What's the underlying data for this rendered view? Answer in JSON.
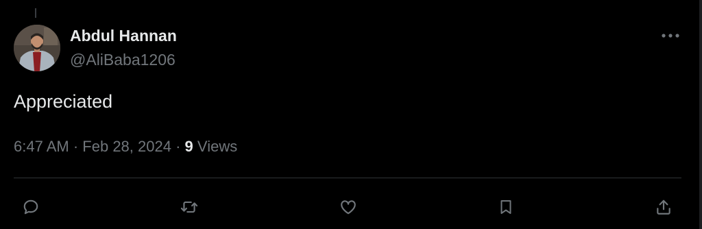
{
  "tweet": {
    "author": {
      "display_name": "Abdul Hannan",
      "handle": "@AliBaba1206",
      "avatar": "profile-photo"
    },
    "text": "Appreciated",
    "time": "6:47 AM",
    "separator": "·",
    "date": "Feb 28, 2024",
    "views_count": "9",
    "views_label": "Views"
  },
  "icons": {
    "more": "more-horizontal-icon",
    "reply": "reply-icon",
    "retweet": "retweet-icon",
    "like": "heart-icon",
    "bookmark": "bookmark-icon",
    "share": "share-icon"
  },
  "colors": {
    "background": "#000000",
    "primary_text": "#e7e9ea",
    "secondary_text": "#71767b",
    "divider": "#2f3336"
  }
}
